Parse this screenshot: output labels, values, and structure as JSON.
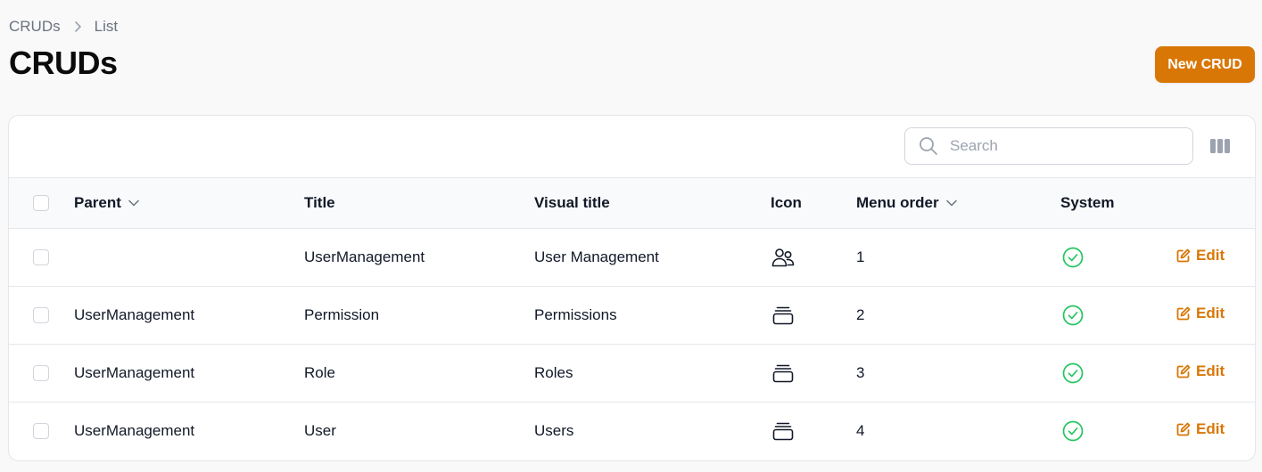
{
  "breadcrumb": {
    "root": "CRUDs",
    "current": "List"
  },
  "page": {
    "title": "CRUDs",
    "new_button": "New CRUD"
  },
  "toolbar": {
    "search_placeholder": "Search"
  },
  "table": {
    "headers": {
      "parent": "Parent",
      "title": "Title",
      "visual_title": "Visual title",
      "icon": "Icon",
      "menu_order": "Menu order",
      "system": "System"
    },
    "rows": [
      {
        "parent": "",
        "title": "UserManagement",
        "visual_title": "User Management",
        "icon": "users-icon",
        "menu_order": "1",
        "system": true,
        "action": "Edit"
      },
      {
        "parent": "UserManagement",
        "title": "Permission",
        "visual_title": "Permissions",
        "icon": "rectangle-stack-icon",
        "menu_order": "2",
        "system": true,
        "action": "Edit"
      },
      {
        "parent": "UserManagement",
        "title": "Role",
        "visual_title": "Roles",
        "icon": "rectangle-stack-icon",
        "menu_order": "3",
        "system": true,
        "action": "Edit"
      },
      {
        "parent": "UserManagement",
        "title": "User",
        "visual_title": "Users",
        "icon": "rectangle-stack-icon",
        "menu_order": "4",
        "system": true,
        "action": "Edit"
      }
    ]
  },
  "colors": {
    "accent": "#d97706",
    "success": "#22c55e",
    "border": "#e5e7eb",
    "background": "#f9f9f9"
  }
}
